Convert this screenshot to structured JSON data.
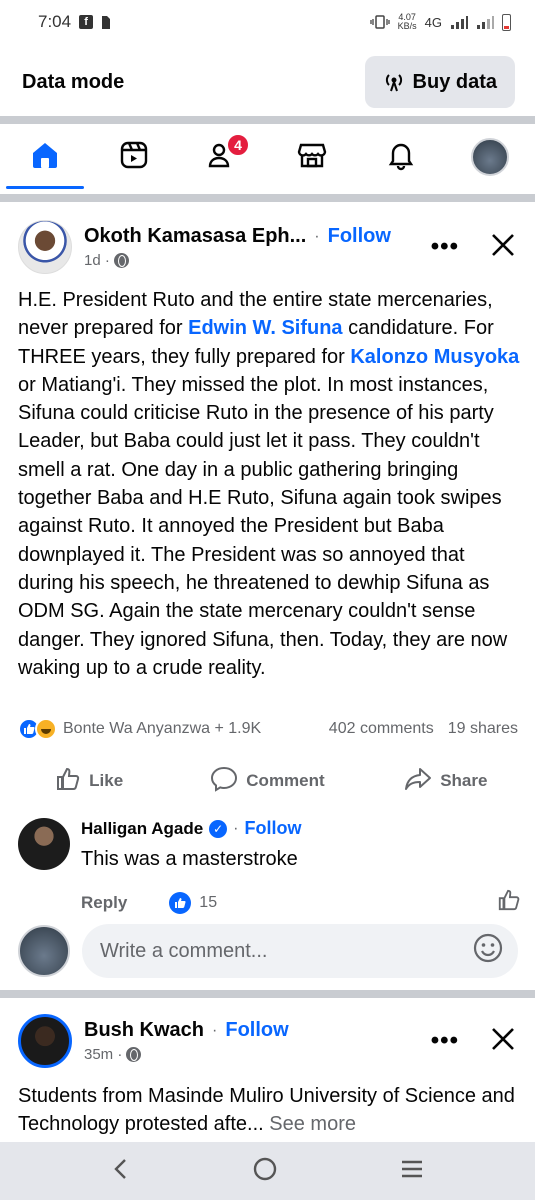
{
  "status": {
    "time": "7:04",
    "speed_value": "4.07",
    "speed_unit": "KB/s",
    "network": "4G"
  },
  "topbar": {
    "data_mode": "Data mode",
    "buy_data": "Buy data"
  },
  "nav": {
    "friends_badge": "4"
  },
  "post1": {
    "author": "Okoth Kamasasa Eph...",
    "separator": "·",
    "follow": "Follow",
    "more": "•••",
    "time": "1d ·",
    "body_1": "H.E. President Ruto and the entire state mercenaries, never prepared for ",
    "mention_1": "Edwin W. Sifuna",
    "body_2": " candidature. For THREE years, they fully prepared for ",
    "mention_2": "Kalonzo Musyoka",
    "body_3": " or Matiang'i. They missed the plot. In most instances, Sifuna could criticise Ruto in the presence of his party Leader, but Baba could just let it pass. They couldn't smell a rat. One day in a public gathering bringing together Baba and H.E Ruto, Sifuna again took swipes against Ruto. It annoyed the President but Baba downplayed it. The President was so annoyed that during his speech, he threatened to dewhip Sifuna as ODM SG. Again the state mercenary couldn't sense danger. They ignored Sifuna, then. Today, they are now waking up to a crude reality.",
    "reactors": "Bonte Wa Anyanzwa + 1.9K",
    "comments": "402 comments",
    "shares": "19 shares"
  },
  "actions": {
    "like": "Like",
    "comment": "Comment",
    "share": "Share"
  },
  "comment": {
    "name": "Halligan Agade",
    "separator": "·",
    "follow": "Follow",
    "text": "This was a masterstroke",
    "reply": "Reply",
    "likes": "15"
  },
  "write": {
    "placeholder": "Write a comment..."
  },
  "post2": {
    "author": "Bush Kwach",
    "separator": "·",
    "follow": "Follow",
    "more": "•••",
    "time": "35m ·",
    "text": "Students from Masinde Muliro University of Science and Technology protested afte...",
    "see_more": "See more"
  },
  "colors": {
    "accent": "#0866ff",
    "badge": "#e41e3f",
    "muted": "#65676b"
  }
}
